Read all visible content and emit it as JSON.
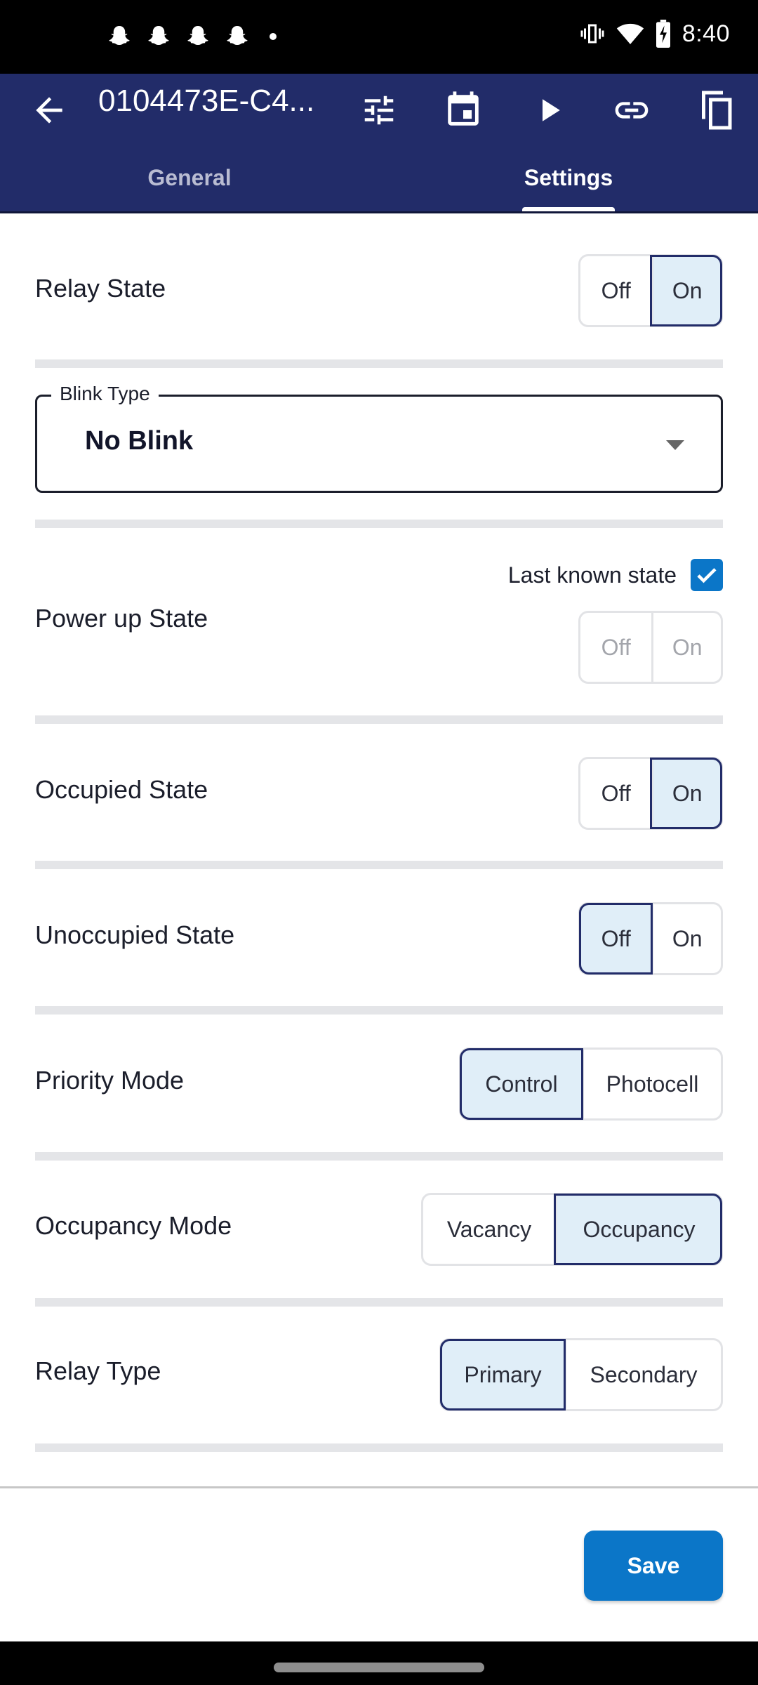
{
  "status_bar": {
    "notification_icons": [
      "snapchat-icon",
      "snapchat-icon",
      "snapchat-icon",
      "snapchat-icon",
      "more-dot"
    ],
    "system_icons": [
      "vibrate-icon",
      "wifi-icon",
      "battery-charging-icon"
    ],
    "time": "8:40"
  },
  "app_bar": {
    "title": "0104473E-C4...",
    "actions": [
      "tune-icon",
      "calendar-icon",
      "play-icon",
      "link-icon",
      "copy-icon"
    ],
    "tabs": [
      {
        "label": "General",
        "active": false
      },
      {
        "label": "Settings",
        "active": true
      }
    ]
  },
  "settings": {
    "relay_state": {
      "label": "Relay State",
      "options": [
        "Off",
        "On"
      ],
      "selected": "On"
    },
    "blink_type": {
      "label": "Blink Type",
      "value": "No Blink"
    },
    "power_up_state": {
      "label": "Power up State",
      "last_known_label": "Last known state",
      "last_known_checked": true,
      "options": [
        "Off",
        "On"
      ],
      "selected": null,
      "disabled": true
    },
    "occupied_state": {
      "label": "Occupied State",
      "options": [
        "Off",
        "On"
      ],
      "selected": "On"
    },
    "unoccupied_state": {
      "label": "Unoccupied State",
      "options": [
        "Off",
        "On"
      ],
      "selected": "Off"
    },
    "priority_mode": {
      "label": "Priority Mode",
      "options": [
        "Control",
        "Photocell"
      ],
      "selected": "Control"
    },
    "occupancy_mode": {
      "label": "Occupancy Mode",
      "options": [
        "Vacancy",
        "Occupancy"
      ],
      "selected": "Occupancy"
    },
    "relay_type": {
      "label": "Relay Type",
      "options": [
        "Primary",
        "Secondary"
      ],
      "selected": "Primary"
    }
  },
  "footer": {
    "save_label": "Save"
  },
  "colors": {
    "app_bar": "#222c69",
    "accent": "#0b76c8",
    "selected_bg": "#e0eef8",
    "divider": "#e4e5e8"
  }
}
